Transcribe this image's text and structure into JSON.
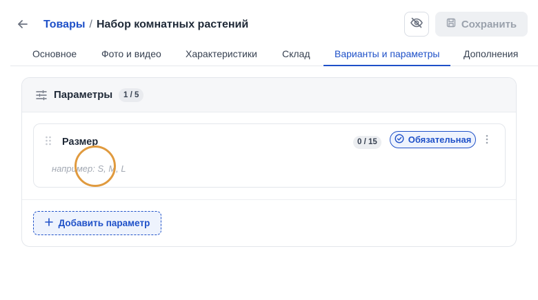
{
  "header": {
    "breadcrumb_parent": "Товары",
    "breadcrumb_separator": "/",
    "title": "Набор комнатных растений",
    "save_label": "Сохранить"
  },
  "tabs": [
    {
      "label": "Основное",
      "active": false
    },
    {
      "label": "Фото и видео",
      "active": false
    },
    {
      "label": "Характеристики",
      "active": false
    },
    {
      "label": "Склад",
      "active": false
    },
    {
      "label": "Варианты и параметры",
      "active": true
    },
    {
      "label": "Дополнения",
      "active": false
    }
  ],
  "params_card": {
    "title": "Параметры",
    "count": "1 / 5",
    "items": [
      {
        "name": "Размер",
        "count": "0 / 15",
        "required_label": "Обязательная",
        "placeholder": "например: S, M, L"
      }
    ],
    "add_label": "Добавить параметр"
  },
  "colors": {
    "accent": "#1e50c8",
    "highlight_ring": "#e09a3e"
  },
  "icons": [
    "back-arrow-icon",
    "eye-off-icon",
    "save-disk-icon",
    "sliders-icon",
    "drag-handle-icon",
    "check-circle-icon",
    "more-vertical-icon",
    "plus-icon"
  ]
}
